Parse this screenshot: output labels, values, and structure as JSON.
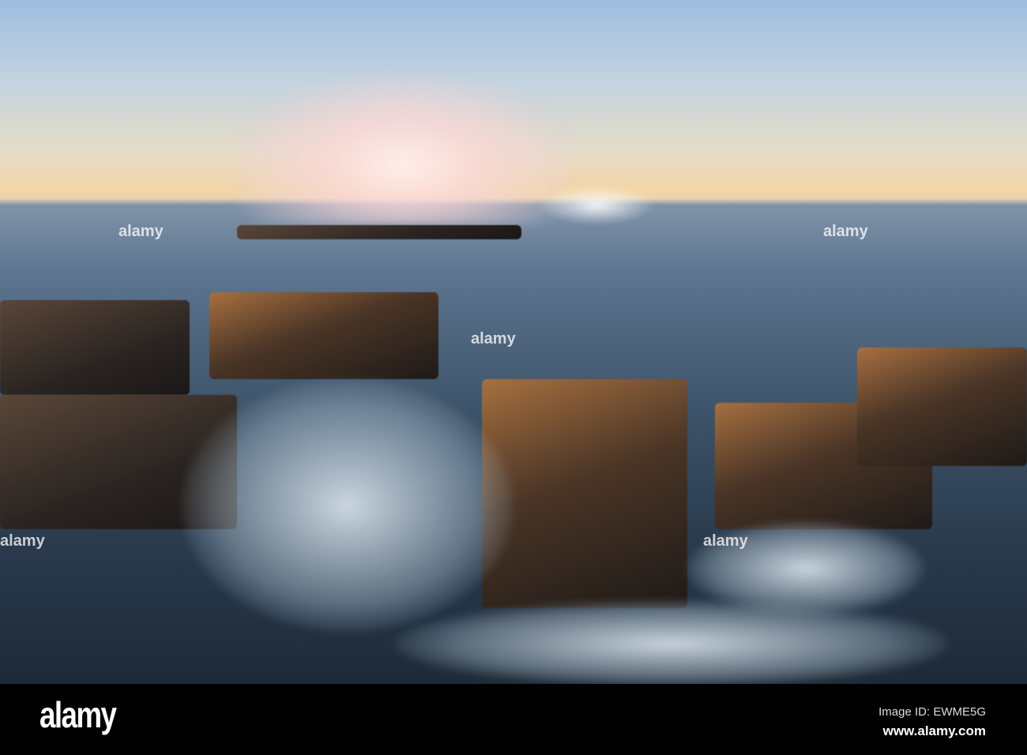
{
  "photo": {
    "subject": "Waves crashing over rock shelf at sunrise",
    "watermark": "alamy"
  },
  "footer": {
    "logo": "alamy",
    "image_id": "Image ID: EWME5G",
    "website": "www.alamy.com"
  }
}
